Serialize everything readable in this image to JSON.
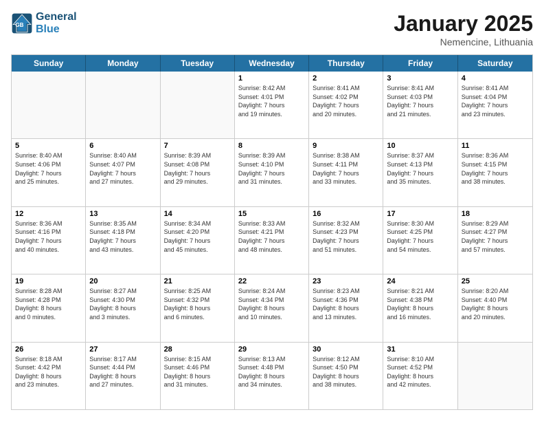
{
  "header": {
    "logo_line1": "General",
    "logo_line2": "Blue",
    "month": "January 2025",
    "location": "Nemencine, Lithuania"
  },
  "weekdays": [
    "Sunday",
    "Monday",
    "Tuesday",
    "Wednesday",
    "Thursday",
    "Friday",
    "Saturday"
  ],
  "weeks": [
    [
      {
        "day": "",
        "lines": []
      },
      {
        "day": "",
        "lines": []
      },
      {
        "day": "",
        "lines": []
      },
      {
        "day": "1",
        "lines": [
          "Sunrise: 8:42 AM",
          "Sunset: 4:01 PM",
          "Daylight: 7 hours",
          "and 19 minutes."
        ]
      },
      {
        "day": "2",
        "lines": [
          "Sunrise: 8:41 AM",
          "Sunset: 4:02 PM",
          "Daylight: 7 hours",
          "and 20 minutes."
        ]
      },
      {
        "day": "3",
        "lines": [
          "Sunrise: 8:41 AM",
          "Sunset: 4:03 PM",
          "Daylight: 7 hours",
          "and 21 minutes."
        ]
      },
      {
        "day": "4",
        "lines": [
          "Sunrise: 8:41 AM",
          "Sunset: 4:04 PM",
          "Daylight: 7 hours",
          "and 23 minutes."
        ]
      }
    ],
    [
      {
        "day": "5",
        "lines": [
          "Sunrise: 8:40 AM",
          "Sunset: 4:06 PM",
          "Daylight: 7 hours",
          "and 25 minutes."
        ]
      },
      {
        "day": "6",
        "lines": [
          "Sunrise: 8:40 AM",
          "Sunset: 4:07 PM",
          "Daylight: 7 hours",
          "and 27 minutes."
        ]
      },
      {
        "day": "7",
        "lines": [
          "Sunrise: 8:39 AM",
          "Sunset: 4:08 PM",
          "Daylight: 7 hours",
          "and 29 minutes."
        ]
      },
      {
        "day": "8",
        "lines": [
          "Sunrise: 8:39 AM",
          "Sunset: 4:10 PM",
          "Daylight: 7 hours",
          "and 31 minutes."
        ]
      },
      {
        "day": "9",
        "lines": [
          "Sunrise: 8:38 AM",
          "Sunset: 4:11 PM",
          "Daylight: 7 hours",
          "and 33 minutes."
        ]
      },
      {
        "day": "10",
        "lines": [
          "Sunrise: 8:37 AM",
          "Sunset: 4:13 PM",
          "Daylight: 7 hours",
          "and 35 minutes."
        ]
      },
      {
        "day": "11",
        "lines": [
          "Sunrise: 8:36 AM",
          "Sunset: 4:15 PM",
          "Daylight: 7 hours",
          "and 38 minutes."
        ]
      }
    ],
    [
      {
        "day": "12",
        "lines": [
          "Sunrise: 8:36 AM",
          "Sunset: 4:16 PM",
          "Daylight: 7 hours",
          "and 40 minutes."
        ]
      },
      {
        "day": "13",
        "lines": [
          "Sunrise: 8:35 AM",
          "Sunset: 4:18 PM",
          "Daylight: 7 hours",
          "and 43 minutes."
        ]
      },
      {
        "day": "14",
        "lines": [
          "Sunrise: 8:34 AM",
          "Sunset: 4:20 PM",
          "Daylight: 7 hours",
          "and 45 minutes."
        ]
      },
      {
        "day": "15",
        "lines": [
          "Sunrise: 8:33 AM",
          "Sunset: 4:21 PM",
          "Daylight: 7 hours",
          "and 48 minutes."
        ]
      },
      {
        "day": "16",
        "lines": [
          "Sunrise: 8:32 AM",
          "Sunset: 4:23 PM",
          "Daylight: 7 hours",
          "and 51 minutes."
        ]
      },
      {
        "day": "17",
        "lines": [
          "Sunrise: 8:30 AM",
          "Sunset: 4:25 PM",
          "Daylight: 7 hours",
          "and 54 minutes."
        ]
      },
      {
        "day": "18",
        "lines": [
          "Sunrise: 8:29 AM",
          "Sunset: 4:27 PM",
          "Daylight: 7 hours",
          "and 57 minutes."
        ]
      }
    ],
    [
      {
        "day": "19",
        "lines": [
          "Sunrise: 8:28 AM",
          "Sunset: 4:28 PM",
          "Daylight: 8 hours",
          "and 0 minutes."
        ]
      },
      {
        "day": "20",
        "lines": [
          "Sunrise: 8:27 AM",
          "Sunset: 4:30 PM",
          "Daylight: 8 hours",
          "and 3 minutes."
        ]
      },
      {
        "day": "21",
        "lines": [
          "Sunrise: 8:25 AM",
          "Sunset: 4:32 PM",
          "Daylight: 8 hours",
          "and 6 minutes."
        ]
      },
      {
        "day": "22",
        "lines": [
          "Sunrise: 8:24 AM",
          "Sunset: 4:34 PM",
          "Daylight: 8 hours",
          "and 10 minutes."
        ]
      },
      {
        "day": "23",
        "lines": [
          "Sunrise: 8:23 AM",
          "Sunset: 4:36 PM",
          "Daylight: 8 hours",
          "and 13 minutes."
        ]
      },
      {
        "day": "24",
        "lines": [
          "Sunrise: 8:21 AM",
          "Sunset: 4:38 PM",
          "Daylight: 8 hours",
          "and 16 minutes."
        ]
      },
      {
        "day": "25",
        "lines": [
          "Sunrise: 8:20 AM",
          "Sunset: 4:40 PM",
          "Daylight: 8 hours",
          "and 20 minutes."
        ]
      }
    ],
    [
      {
        "day": "26",
        "lines": [
          "Sunrise: 8:18 AM",
          "Sunset: 4:42 PM",
          "Daylight: 8 hours",
          "and 23 minutes."
        ]
      },
      {
        "day": "27",
        "lines": [
          "Sunrise: 8:17 AM",
          "Sunset: 4:44 PM",
          "Daylight: 8 hours",
          "and 27 minutes."
        ]
      },
      {
        "day": "28",
        "lines": [
          "Sunrise: 8:15 AM",
          "Sunset: 4:46 PM",
          "Daylight: 8 hours",
          "and 31 minutes."
        ]
      },
      {
        "day": "29",
        "lines": [
          "Sunrise: 8:13 AM",
          "Sunset: 4:48 PM",
          "Daylight: 8 hours",
          "and 34 minutes."
        ]
      },
      {
        "day": "30",
        "lines": [
          "Sunrise: 8:12 AM",
          "Sunset: 4:50 PM",
          "Daylight: 8 hours",
          "and 38 minutes."
        ]
      },
      {
        "day": "31",
        "lines": [
          "Sunrise: 8:10 AM",
          "Sunset: 4:52 PM",
          "Daylight: 8 hours",
          "and 42 minutes."
        ]
      },
      {
        "day": "",
        "lines": []
      }
    ]
  ]
}
